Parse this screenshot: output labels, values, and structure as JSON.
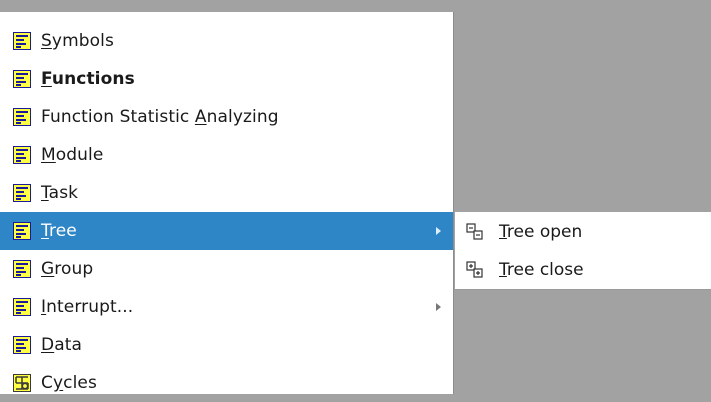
{
  "menu": {
    "items": [
      {
        "pre": "",
        "u": "S",
        "post": "ymbols",
        "icon": "list-icon"
      },
      {
        "pre": "",
        "u": "F",
        "post": "unctions",
        "icon": "list-icon",
        "bold": true
      },
      {
        "pre": "Function Statistic ",
        "u": "A",
        "post": "nalyzing",
        "icon": "list-icon"
      },
      {
        "pre": "",
        "u": "M",
        "post": "odule",
        "icon": "list-icon"
      },
      {
        "pre": "",
        "u": "T",
        "post": "ask",
        "icon": "list-icon"
      },
      {
        "pre": "",
        "u": "T",
        "post": "ree",
        "icon": "list-icon",
        "selected": true,
        "submenu": true
      },
      {
        "pre": "",
        "u": "G",
        "post": "roup",
        "icon": "list-icon"
      },
      {
        "pre": "",
        "u": "I",
        "post": "nterrupt...",
        "icon": "list-icon",
        "submenu": true
      },
      {
        "pre": "",
        "u": "D",
        "post": "ata",
        "icon": "list-icon"
      },
      {
        "pre": "C",
        "u": "y",
        "post": "cles",
        "icon": "cycles-icon"
      }
    ]
  },
  "submenu": {
    "items": [
      {
        "u": "T",
        "post": "ree open",
        "icon": "tree-open-icon"
      },
      {
        "u": "T",
        "post": "ree close",
        "icon": "tree-close-icon"
      }
    ]
  }
}
